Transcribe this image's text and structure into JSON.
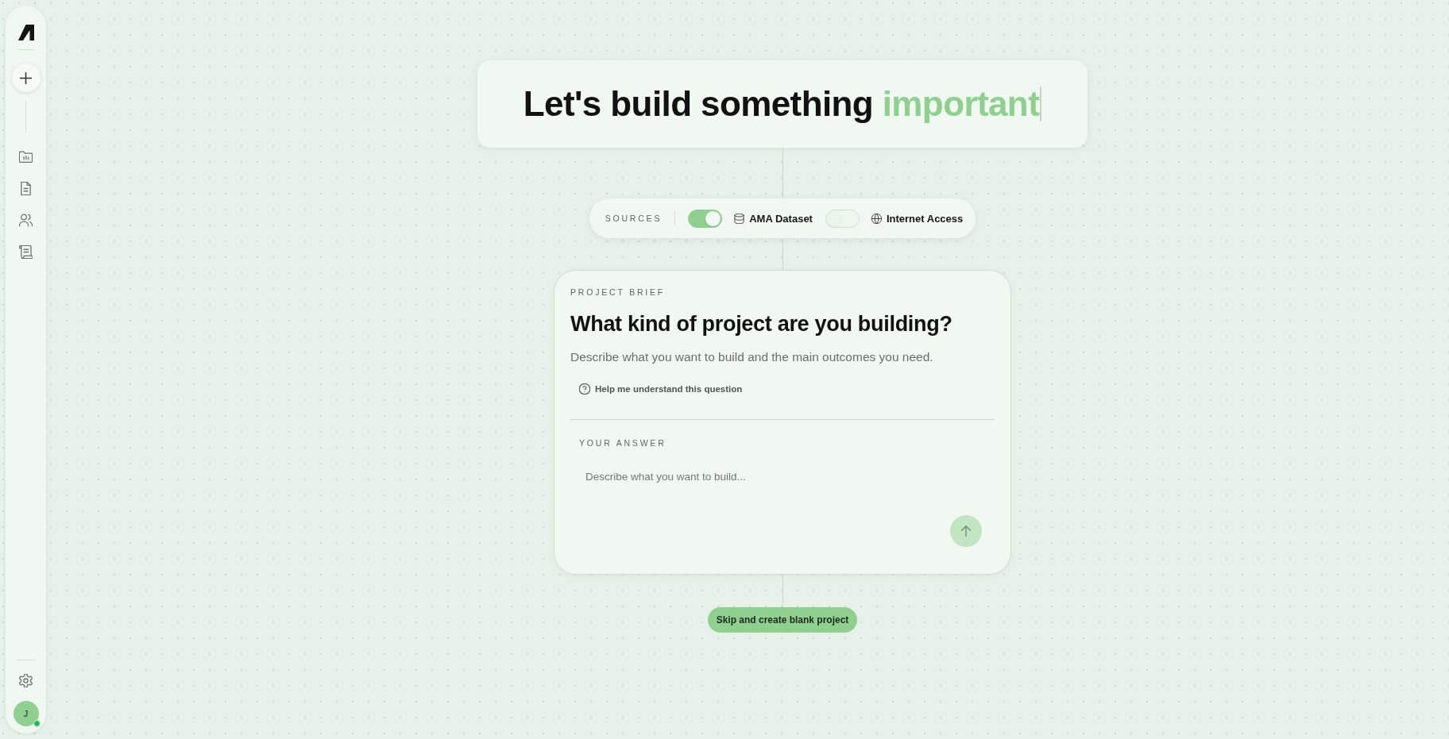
{
  "sidebar": {
    "nav_items": [
      {
        "selected": false
      },
      {
        "selected": false
      },
      {
        "selected": false
      },
      {
        "selected": false
      }
    ],
    "user": {
      "initial": "J",
      "online": true
    }
  },
  "heading": {
    "text": "Let's build something",
    "accent": "important"
  },
  "sources": {
    "label": "SOURCES",
    "items": [
      {
        "name": "AMA Dataset",
        "on": true
      },
      {
        "name": "Internet Access",
        "on": false
      }
    ]
  },
  "brief": {
    "eyebrow": "PROJECT BRIEF",
    "question": "What kind of project are you building?",
    "description": "Describe what you want to build and the main outcomes you need.",
    "help_link": "Help me understand this question",
    "answer_label": "YOUR ANSWER",
    "answer": {
      "placeholder": "Describe what you want to build..."
    },
    "send_button": {
      "disabled": true
    }
  },
  "skip_button": {
    "label": "Skip and create blank project"
  }
}
